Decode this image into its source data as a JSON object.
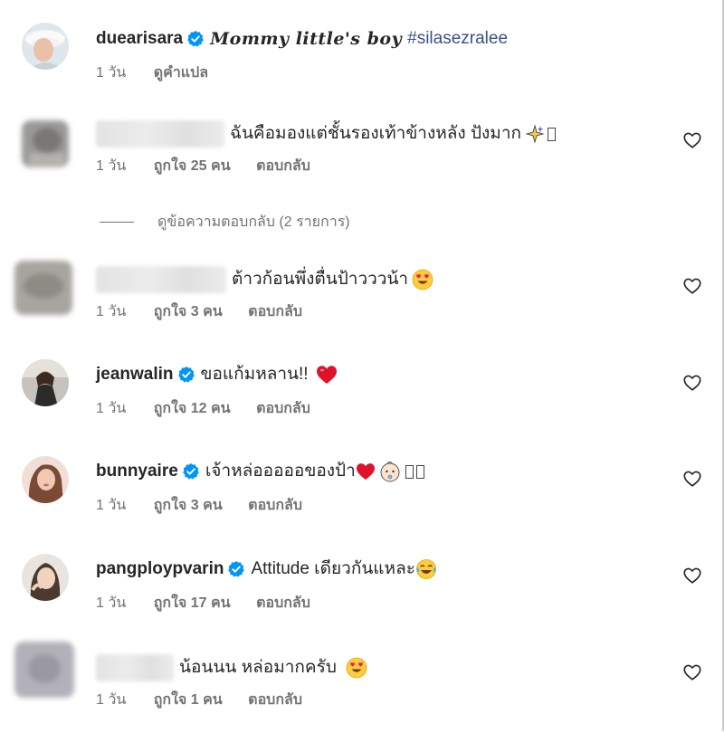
{
  "caption": {
    "username": "duearisara",
    "text": "Mommy little's boy",
    "hashtag": "#silasezralee",
    "time": "1 วัน",
    "translate": "ดูคำแปล"
  },
  "comments": [
    {
      "username": "",
      "text": "ฉันคือมองแต่ชั้นรองเท้าข้างหลัง ปังมาก",
      "time": "1 วัน",
      "likes": "ถูกใจ 25 คน",
      "reply": "ตอบกลับ"
    },
    {
      "username": "",
      "text": "ต้าวก้อนพึ่งตื่นป้าวววน้า",
      "time": "1 วัน",
      "likes": "ถูกใจ 3 คน",
      "reply": "ตอบกลับ"
    },
    {
      "username": "jeanwalin",
      "text": "ขอแก้มหลาน!!",
      "time": "1 วัน",
      "likes": "ถูกใจ 12 คน",
      "reply": "ตอบกลับ"
    },
    {
      "username": "bunnyaire",
      "text": "เจ้าหล่อออออของป้า",
      "time": "1 วัน",
      "likes": "ถูกใจ 3 คน",
      "reply": "ตอบกลับ"
    },
    {
      "username": "pangploypvarin",
      "text": "Attitude เดียวกันแหละ",
      "time": "1 วัน",
      "likes": "ถูกใจ 17 คน",
      "reply": "ตอบกลับ"
    },
    {
      "username": "",
      "text": "น้อนนน หล่อมากครับ",
      "time": "1 วัน",
      "likes": "ถูกใจ 1 คน",
      "reply": "ตอบกลับ"
    }
  ],
  "view_replies": "ดูข้อความตอบกลับ (2 รายการ)",
  "icons": {
    "verified": "verified-badge-icon",
    "like": "heart-outline-icon",
    "verified_color": "#0095f6"
  }
}
